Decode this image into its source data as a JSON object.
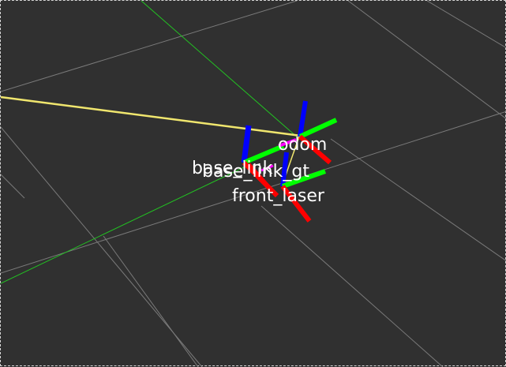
{
  "view": {
    "background_color": "#303030",
    "grid_color": "#8c8c8c"
  },
  "frames": {
    "odom": "odom",
    "base_link": "base_link",
    "base_link_gt": "base_link_gt",
    "front_laser": "front_laser"
  },
  "colors": {
    "axis_x": "#ff0000",
    "axis_y": "#00ff00",
    "axis_z": "#0000ff",
    "tf_link": "#f0e66e",
    "highlight": "#ff00ff"
  }
}
